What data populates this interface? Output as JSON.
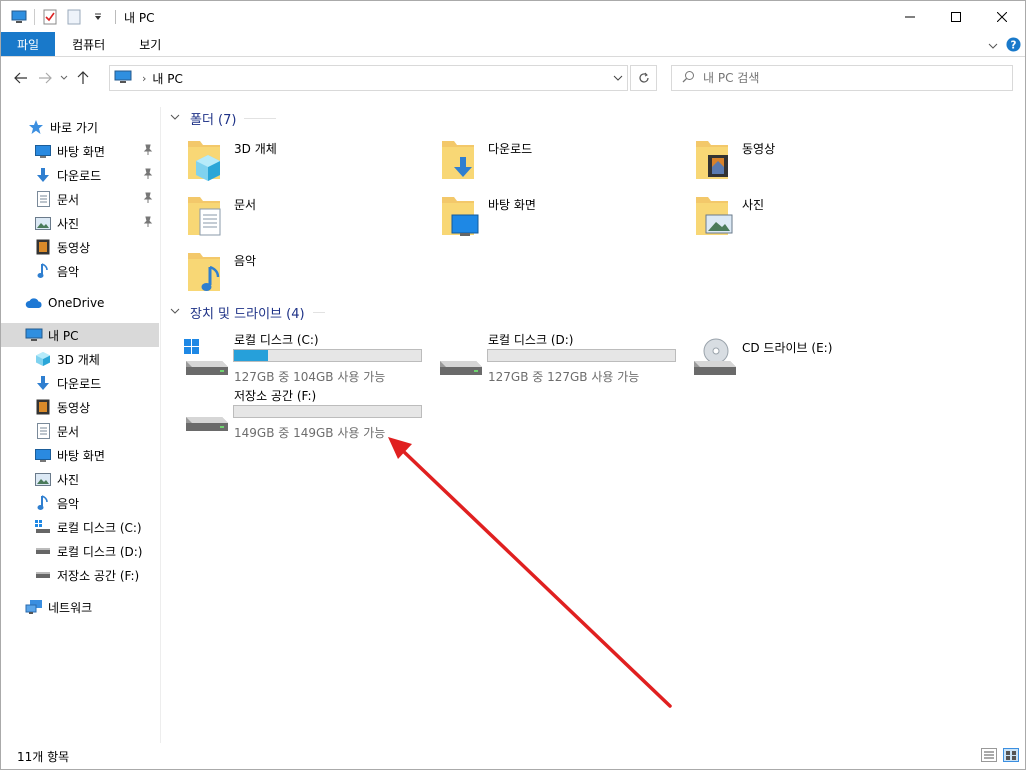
{
  "window": {
    "title": "내 PC"
  },
  "ribbon": {
    "tabs": [
      "파일",
      "컴퓨터",
      "보기"
    ]
  },
  "address": {
    "path": "내 PC",
    "search_placeholder": "내 PC 검색"
  },
  "sidebar": {
    "quick_access": "바로 가기",
    "quick_items": [
      "바탕 화면",
      "다운로드",
      "문서",
      "사진",
      "동영상",
      "음악"
    ],
    "onedrive": "OneDrive",
    "this_pc": "내 PC",
    "pc_items": [
      "3D 개체",
      "다운로드",
      "동영상",
      "문서",
      "바탕 화면",
      "사진",
      "음악",
      "로컬 디스크 (C:)",
      "로컬 디스크 (D:)",
      "저장소 공간 (F:)"
    ],
    "network": "네트워크"
  },
  "groups": {
    "folders_title": "폴더 (7)",
    "devices_title": "장치 및 드라이브 (4)"
  },
  "folders": [
    "3D 개체",
    "다운로드",
    "동영상",
    "문서",
    "바탕 화면",
    "사진",
    "음악"
  ],
  "drives": [
    {
      "name": "로컬 디스크 (C:)",
      "info": "127GB 중 104GB 사용 가능",
      "used_fraction": 0.18
    },
    {
      "name": "로컬 디스크 (D:)",
      "info": "127GB 중 127GB 사용 가능",
      "used_fraction": 0.0
    },
    {
      "name": "CD 드라이브 (E:)",
      "info": "",
      "used_fraction": null
    },
    {
      "name": "저장소 공간 (F:)",
      "info": "149GB 중 149GB 사용 가능",
      "used_fraction": 0.0
    }
  ],
  "status": {
    "count": "11개 항목"
  },
  "colors": {
    "accent": "#1979ca",
    "drive_fill": "#26a0da",
    "annotation_arrow": "#e02020"
  }
}
